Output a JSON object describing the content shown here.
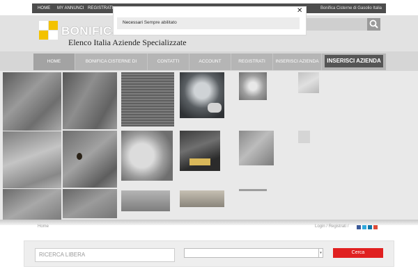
{
  "topbar": {
    "links": [
      "HOME",
      "MY ANNUNCI",
      "REGISTRATI"
    ],
    "right_text": "Bonifica Cisterne di Gasolio Italia"
  },
  "header": {
    "logo_text": "BONIFICA CISTERNE",
    "logo_subtitle": "Elenco Italia Aziende Specializzate",
    "search_icon": "search-icon"
  },
  "nav": {
    "items": [
      "HOME",
      "BONIFICA CISTERNE DI GASOLIO",
      "CONTATTI",
      "ACCOUNT",
      "REGISTRATI",
      "INSERISCI AZIENDA"
    ],
    "cta": "INSERISCI AZIENDA"
  },
  "breadcrumb": {
    "home": "Home",
    "login": "Login",
    "register": "Registrati",
    "separator": "/"
  },
  "social": [
    "facebook-icon",
    "twitter-icon",
    "linkedin-icon",
    "googleplus-icon"
  ],
  "search": {
    "placeholder": "RICERCA LIBERA",
    "select_value": "",
    "button": "Cerca"
  },
  "cookie_modal": {
    "category": "Necessari",
    "status": "Sempre abilitato",
    "close_icon": "close-icon"
  },
  "colors": {
    "accent_yellow": "#f3c200",
    "cerca_red": "#e02020",
    "topbar": "#4d4d4d",
    "nav_cta": "#555555"
  }
}
